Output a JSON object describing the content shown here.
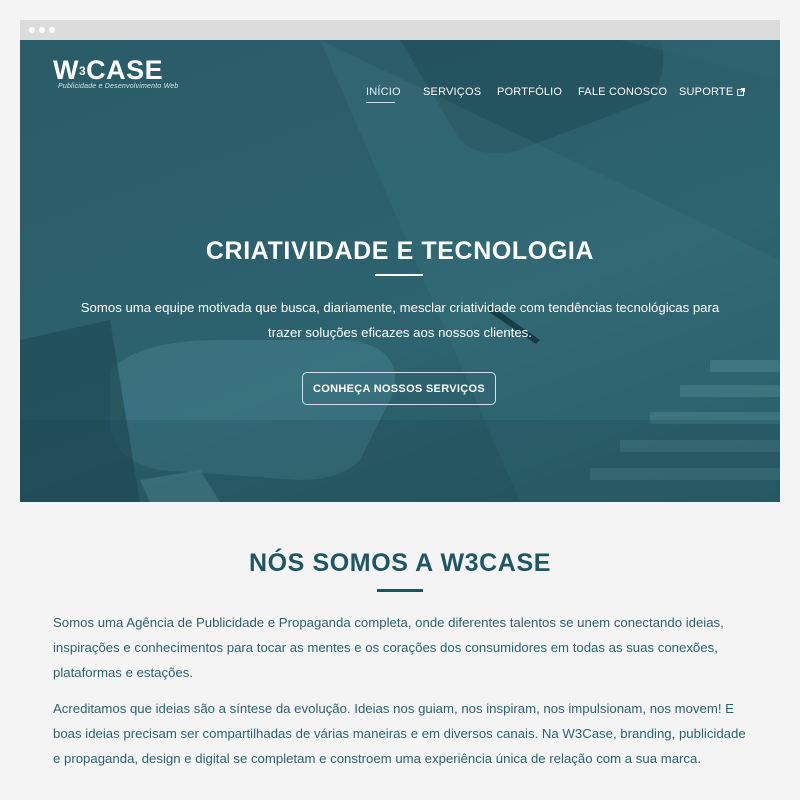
{
  "window": {
    "controls": [
      "dot",
      "dot",
      "dot"
    ]
  },
  "logo": {
    "name": "CASE",
    "prefix": "W",
    "superscript": "3",
    "tagline": "Publicidade e Desenvolvimento Web"
  },
  "nav": {
    "items": [
      {
        "label": "INÍCIO",
        "active": true
      },
      {
        "label": "SERVIÇOS",
        "active": false
      },
      {
        "label": "PORTFÓLIO",
        "active": false
      },
      {
        "label": "FALE CONOSCO",
        "active": false
      },
      {
        "label": "SUPORTE",
        "active": false,
        "icon": "external-link-icon"
      }
    ]
  },
  "hero": {
    "title": "CRIATIVIDADE E TECNOLOGIA",
    "text_line1": "Somos uma equipe motivada que busca, diariamente, mesclar criatividade  com tendências tecnológicas para",
    "text_line2": "trazer soluções eficazes aos nossos  clientes.",
    "button_label": "CONHEÇA NOSSOS SERVIÇOS"
  },
  "about": {
    "title": "NÓS SOMOS A W3CASE",
    "paragraph1": [
      "Somos uma Agência de Publicidade e Propaganda completa, onde diferentes talentos se unem conectando ideias,",
      "inspirações e conhecimentos para tocar as mentes e os corações dos consumidores em todas as suas conexões,",
      "plataformas e estações."
    ],
    "paragraph2": [
      "Acreditamos que ideias são a síntese da evolução. Ideias nos guiam, nos inspiram, nos impulsionam, nos movem! E",
      "boas ideias precisam ser compartilhadas de várias maneiras e em diversos canais. Na W3Case, branding, publicidade",
      "e propaganda, design e digital se completam e constroem uma experiência única de relação com a sua marca."
    ]
  },
  "colors": {
    "hero_overlay": "#2a5c68",
    "accent_dark_teal": "#1f5664",
    "body_text": "#2c6270",
    "page_background": "#f4f4f5"
  }
}
